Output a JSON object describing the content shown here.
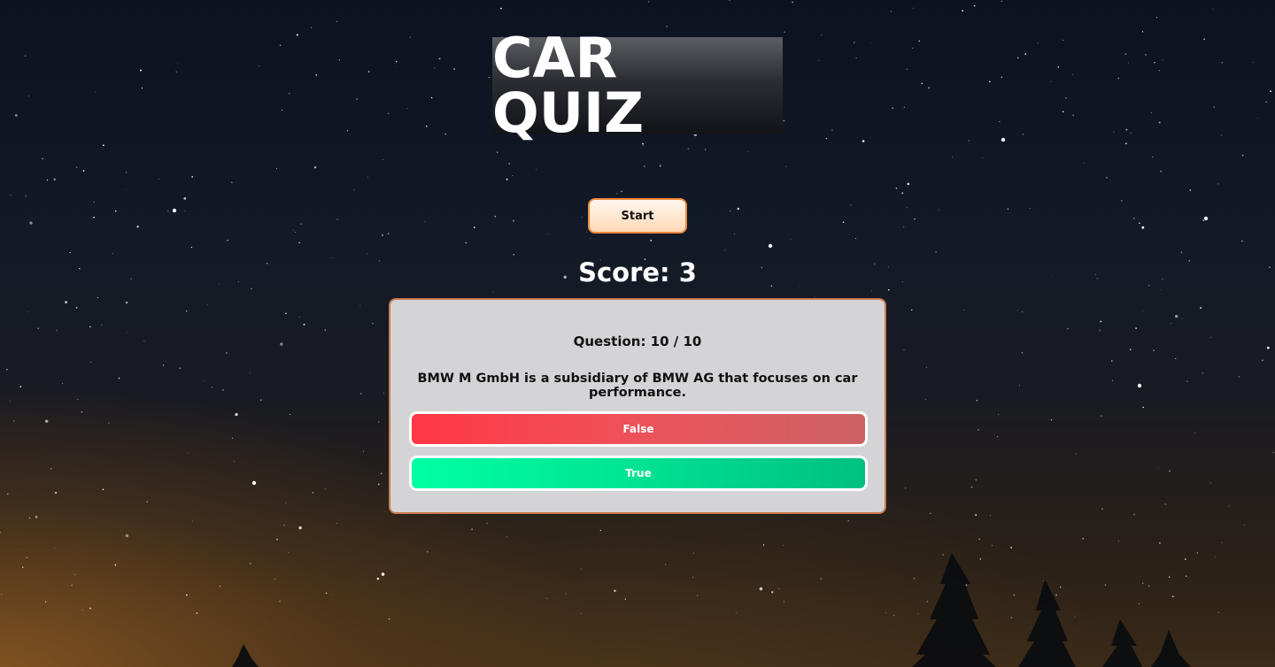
{
  "app": {
    "title": "CAR QUIZ"
  },
  "controls": {
    "start_label": "Start"
  },
  "score": {
    "text": "Score: 3",
    "value": 3
  },
  "question": {
    "counter_text": "Question: 10 / 10",
    "current": 10,
    "total": 10,
    "text": "BMW M GmbH is a subsidiary of BMW AG that focuses on car performance."
  },
  "answers": [
    {
      "label": "False",
      "color": "#ff3845"
    },
    {
      "label": "True",
      "color": "#00ffa3"
    }
  ],
  "theme": {
    "start_border": "#f08a3c",
    "card_background": "#d4d4d6",
    "card_border": "#c97a4d"
  }
}
